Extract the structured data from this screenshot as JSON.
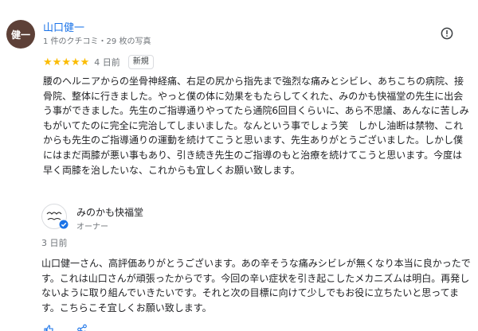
{
  "reviewer": {
    "avatar_text": "健一",
    "name": "山口健一",
    "meta": "1 件のクチコミ・29 枚の写真"
  },
  "rating": {
    "stars": 5,
    "date": "4 日前",
    "badge": "新規"
  },
  "review": {
    "text": "腰のヘルニアからの坐骨神経痛、右足の尻から指先まで強烈な痛みとシビレ、あちこちの病院、接骨院、整体に行きました。やっと僕の体に効果をもたらしてくれた、みのかも快福堂の先生に出会う事ができました。先生のご指導通りやってたら通院6回目くらいに、あら不思議、あんなに苦しみもがいてたのに完全に完治してしまいました。なんという事でしょう笑　しかし油断は禁物、これからも先生のご指導通りの運動を続けてこうと思います、先生ありがとうございました。しかし僕にはまだ両膝が悪い事もあり、引き続き先生のご指導のもと治療を続けてこうと思います。今度は早く両膝を治したいな、これからも宜しくお願い致します。"
  },
  "owner": {
    "name": "みのかも快福堂",
    "role": "オーナー",
    "date": "3 日前",
    "reply": "山口健一さん、高評価ありがとうございます。あの辛そうな痛みシビレが無くなり本当に良かったです。これは山口さんが頑張ったからです。今回の辛い症状を引き起こしたメカニズムは明白。再発しないように取り組んでいきたいです。それと次の目標に向けて少しでもお役に立ちたいと思ってます。こちらこそ宜しくお願い致します。"
  },
  "icons": {
    "more": "info-circle-icon",
    "verified": "verified-check-icon",
    "star": "star-icon"
  },
  "colors": {
    "link": "#1a73e8",
    "star": "#fbbc04",
    "avatar": "#5d4037"
  }
}
